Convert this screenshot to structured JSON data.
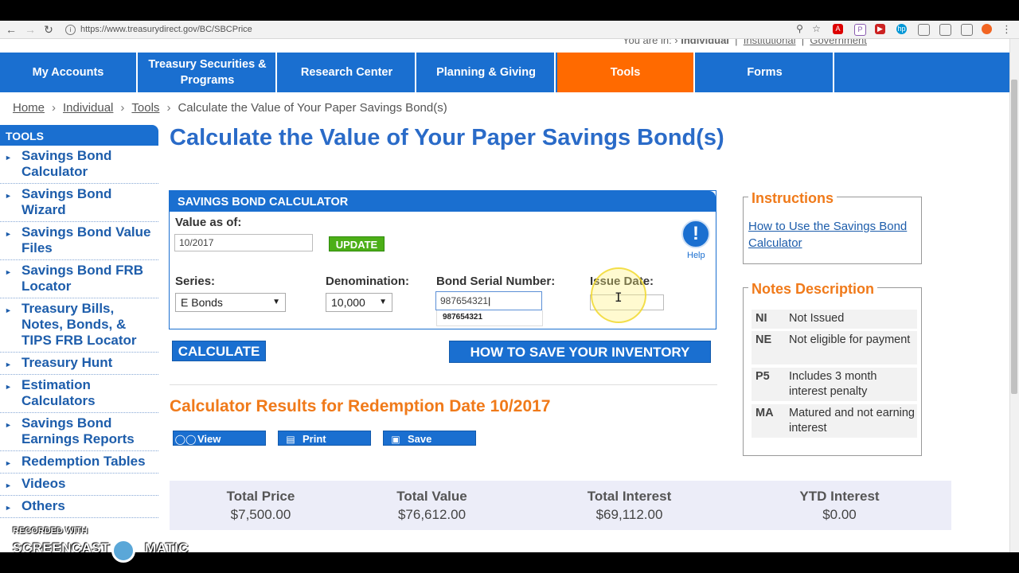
{
  "browser": {
    "url": "https://www.treasurydirect.gov/BC/SBCPrice",
    "extensions": [
      "search-icon",
      "star-icon",
      "abp-icon",
      "p-icon",
      "play-icon",
      "hp-icon",
      "cast-icon",
      "window-icon",
      "screen-icon",
      "orange-icon",
      "menu-icon"
    ]
  },
  "header": {
    "you_are_in": "You are in:",
    "you_are_in_links": [
      "Individual",
      "Institutional",
      "Government"
    ]
  },
  "nav": {
    "items": [
      {
        "label": "My Accounts"
      },
      {
        "label": "Treasury Securities & Programs"
      },
      {
        "label": "Research Center"
      },
      {
        "label": "Planning & Giving"
      },
      {
        "label": "Tools"
      },
      {
        "label": "Forms"
      }
    ],
    "active_color": "#ff6a00",
    "bar_color": "#1a6fd0"
  },
  "breadcrumb": {
    "items": [
      "Home",
      "Individual",
      "Tools"
    ],
    "current": "Calculate the Value of Your Paper Savings Bond(s)"
  },
  "sidebar": {
    "heading": "TOOLS",
    "items": [
      {
        "label": "Savings Bond Calculator"
      },
      {
        "label": "Savings Bond Wizard"
      },
      {
        "label": "Savings Bond Value Files"
      },
      {
        "label": "Savings Bond FRB Locator"
      },
      {
        "label": "Treasury Bills, Notes, Bonds, & TIPS FRB Locator"
      },
      {
        "label": "Treasury Hunt"
      },
      {
        "label": "Estimation Calculators"
      },
      {
        "label": "Savings Bond Earnings Reports"
      },
      {
        "label": "Redemption Tables"
      },
      {
        "label": "Videos"
      },
      {
        "label": "Others"
      }
    ]
  },
  "main": {
    "title": "Calculate the Value of Your Paper Savings Bond(s)",
    "calculator": {
      "heading": "SAVINGS BOND CALCULATOR",
      "value_as_of_label": "Value as of:",
      "value_as_of": "10/2017",
      "update_label": "UPDATE",
      "help_label": "Help",
      "series_label": "Series:",
      "series_value": "E Bonds",
      "denomination_label": "Denomination:",
      "denomination_value": "10,000",
      "serial_label": "Bond Serial Number:",
      "serial_value": "987654321",
      "autocomplete_suggestion": "987654321",
      "issue_date_label": "Issue Date:",
      "issue_date_value": ""
    },
    "calculate_label": "CALCULATE",
    "inventory_label": "HOW TO SAVE YOUR INVENTORY",
    "results_title": "Calculator Results for Redemption Date 10/2017",
    "actions": [
      {
        "label": "View",
        "icon": "glasses-icon"
      },
      {
        "label": "Print",
        "icon": "printer-icon"
      },
      {
        "label": "Save",
        "icon": "floppy-icon"
      }
    ],
    "totals": [
      {
        "label": "Total Price",
        "value": "$7,500.00"
      },
      {
        "label": "Total Value",
        "value": "$76,612.00"
      },
      {
        "label": "Total Interest",
        "value": "$69,112.00"
      },
      {
        "label": "YTD Interest",
        "value": "$0.00"
      }
    ]
  },
  "instructions": {
    "title": "Instructions",
    "link": "How to Use the Savings Bond Calculator"
  },
  "notes": {
    "title": "Notes Description",
    "rows": [
      {
        "code": "NI",
        "desc": "Not Issued"
      },
      {
        "code": "NE",
        "desc": "Not eligible for payment"
      },
      {
        "code": "P5",
        "desc": "Includes 3 month interest penalty"
      },
      {
        "code": "MA",
        "desc": "Matured and not earning interest"
      }
    ]
  },
  "watermark": {
    "small": "RECORDED WITH",
    "big_left": "SCREENCAST",
    "big_right": "MATIC"
  }
}
